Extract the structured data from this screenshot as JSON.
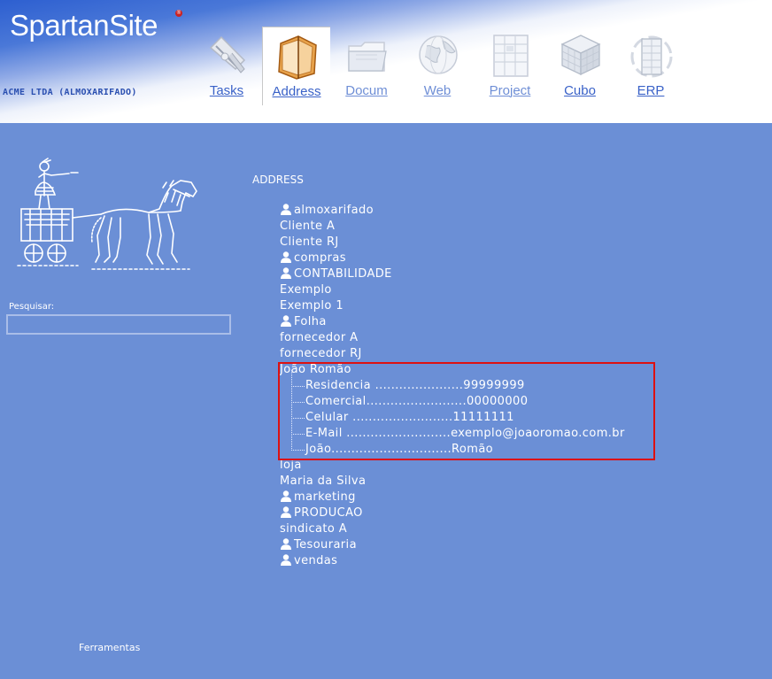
{
  "app": {
    "logo": "SpartanSite",
    "registered_mark": "®",
    "company": "ACME LTDA (ALMOXARIFADO)"
  },
  "nav": [
    {
      "key": "tasks",
      "label": "Tasks",
      "icon": "tasks-icon"
    },
    {
      "key": "address",
      "label": "Address",
      "icon": "address-book-icon",
      "active": true
    },
    {
      "key": "docum",
      "label": "Docum",
      "icon": "folder-icon"
    },
    {
      "key": "web",
      "label": "Web",
      "icon": "globe-icon"
    },
    {
      "key": "project",
      "label": "Project",
      "icon": "project-grid-icon"
    },
    {
      "key": "cubo",
      "label": "Cubo",
      "icon": "cube-icon"
    },
    {
      "key": "erp",
      "label": "ERP",
      "icon": "erp-building-icon"
    }
  ],
  "sidebar": {
    "search_label": "Pesquisar:",
    "search_value": "",
    "tools_label": "Ferramentas"
  },
  "main": {
    "title": "ADDRESS",
    "contacts": [
      {
        "name": "almoxarifado",
        "group": true
      },
      {
        "name": "Cliente A"
      },
      {
        "name": "Cliente RJ"
      },
      {
        "name": "compras",
        "group": true
      },
      {
        "name": "CONTABILIDADE",
        "group": true
      },
      {
        "name": "Exemplo"
      },
      {
        "name": "Exemplo 1"
      },
      {
        "name": "Folha",
        "group": true
      },
      {
        "name": "fornecedor A"
      },
      {
        "name": "fornecedor RJ"
      },
      {
        "name": "João Romão",
        "expanded": true,
        "details": [
          "Residencia ......................99999999",
          "Comercial.........................00000000",
          "Celular  .........................11111111",
          "E-Mail  ..........................exemplo@joaoromao.com.br",
          "João..............................Romão"
        ]
      },
      {
        "name": "loja"
      },
      {
        "name": "Maria da Silva"
      },
      {
        "name": "marketing",
        "group": true
      },
      {
        "name": "PRODUCAO",
        "group": true
      },
      {
        "name": "sindicato A"
      },
      {
        "name": "Tesouraria",
        "group": true
      },
      {
        "name": "vendas",
        "group": true
      }
    ]
  },
  "colors": {
    "background": "#6b8fd6",
    "nav_link": "#3a62c8",
    "highlight": "#dd1111"
  }
}
